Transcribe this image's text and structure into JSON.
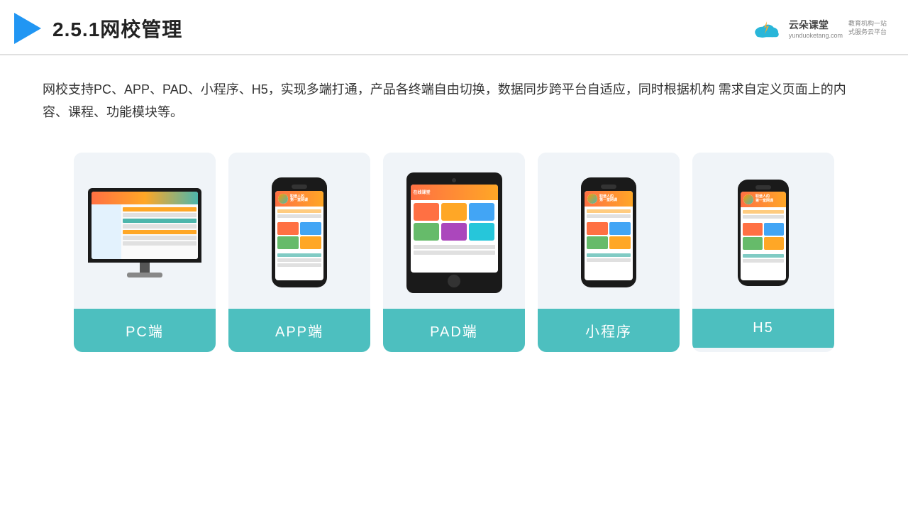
{
  "header": {
    "title": "2.5.1网校管理",
    "logo": {
      "name": "云朵课堂",
      "url": "yunduoketang.com",
      "tagline": "教育机构一站\n式服务云平台"
    }
  },
  "description": "网校支持PC、APP、PAD、小程序、H5，实现多端打通，产品各终端自由切换，数据同步跨平台自适应，同时根据机构\n需求自定义页面上的内容、课程、功能模块等。",
  "cards": [
    {
      "id": "pc",
      "label": "PC端"
    },
    {
      "id": "app",
      "label": "APP端"
    },
    {
      "id": "pad",
      "label": "PAD端"
    },
    {
      "id": "miniprogram",
      "label": "小程序"
    },
    {
      "id": "h5",
      "label": "H5"
    }
  ],
  "colors": {
    "teal": "#4DBFBF",
    "accent_blue": "#2196F3",
    "bg_card": "#f0f4f8"
  }
}
